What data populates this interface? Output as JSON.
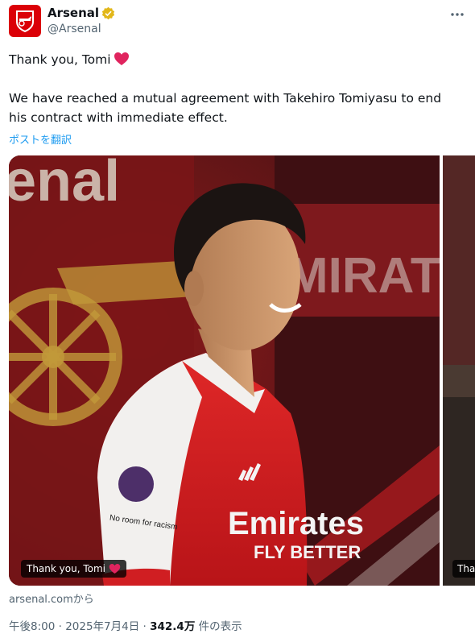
{
  "account": {
    "display_name": "Arsenal",
    "handle": "@Arsenal",
    "verified_badge": "gold-verified-badge"
  },
  "more_icon": "more-horizontal-icon",
  "tweet": {
    "line1": "Thank you, Tomi",
    "line2": "We have reached a mutual agreement with Takehiro Tomiyasu to end his contract with immediate effect.",
    "translate_label": "ポストを翻訳"
  },
  "media": {
    "caption": "Thank you, Tomi",
    "caption_next": "Tha",
    "banner_text_top": "enal",
    "banner_text_side": "MIRAT",
    "shirt_sponsor": "Emirates",
    "shirt_sponsor_line2": "FLY BETTER",
    "sleeve_badge": "No room for racism"
  },
  "source_label": "arsenal.comから",
  "meta": {
    "time": "午後8:00",
    "sep1": " · ",
    "date": "2025年7月4日",
    "sep2": " · ",
    "views_count": "342.4万",
    "views_label": " 件の表示"
  },
  "colors": {
    "arsenal_red": "#db0007",
    "link_blue": "#1d9bf0",
    "secondary_text": "#536471",
    "heart_red": "#e0245e"
  }
}
